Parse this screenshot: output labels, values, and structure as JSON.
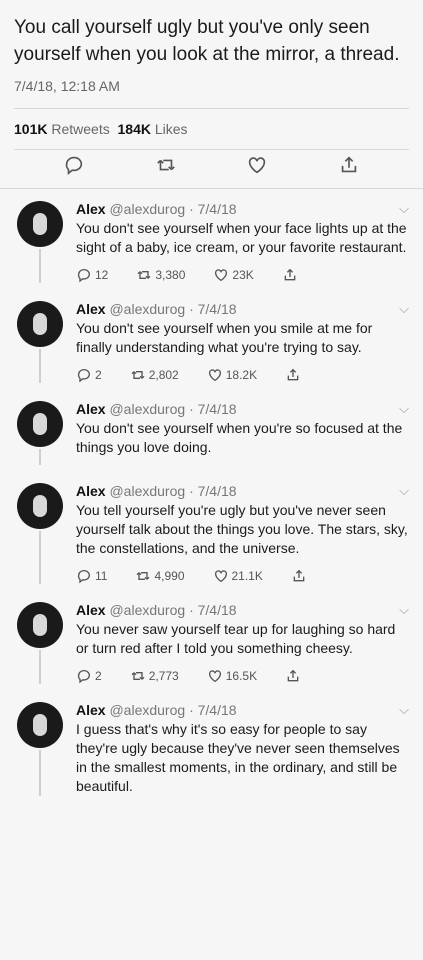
{
  "main": {
    "text": "You call yourself ugly but you've only seen yourself when you look at the mirror, a thread.",
    "time": "7/4/18, 12:18 AM",
    "retweets": "101K",
    "retweets_label": "Retweets",
    "likes": "184K",
    "likes_label": "Likes"
  },
  "replies": [
    {
      "name": "Alex",
      "handle": "@alexdurog",
      "date": "· 7/4/18",
      "text": "You don't see yourself when your face lights up at the sight of a baby, ice cream, or your favorite restaurant.",
      "replies": "12",
      "retweets": "3,380",
      "likes": "23K"
    },
    {
      "name": "Alex",
      "handle": "@alexdurog",
      "date": "· 7/4/18",
      "text": "You don't see yourself when you smile at me for finally understanding what you're trying to say.",
      "replies": "2",
      "retweets": "2,802",
      "likes": "18.2K"
    },
    {
      "name": "Alex",
      "handle": "@alexdurog",
      "date": "· 7/4/18",
      "text": "You don't see yourself when you're so focused at the things you love doing."
    },
    {
      "name": "Alex",
      "handle": "@alexdurog",
      "date": "· 7/4/18",
      "text": "You tell yourself you're ugly but you've never seen yourself talk about the things you love. The stars, sky, the constellations, and the universe.",
      "replies": "11",
      "retweets": "4,990",
      "likes": "21.1K"
    },
    {
      "name": "Alex",
      "handle": "@alexdurog",
      "date": "· 7/4/18",
      "text": "You never saw yourself tear up for laughing so hard or turn red after I told you something cheesy.",
      "replies": "2",
      "retweets": "2,773",
      "likes": "16.5K"
    },
    {
      "name": "Alex",
      "handle": "@alexdurog",
      "date": "· 7/4/18",
      "text": "I guess that's why it's so easy for people to say they're ugly because they've never seen themselves in the smallest moments, in the ordinary, and still be beautiful."
    }
  ]
}
